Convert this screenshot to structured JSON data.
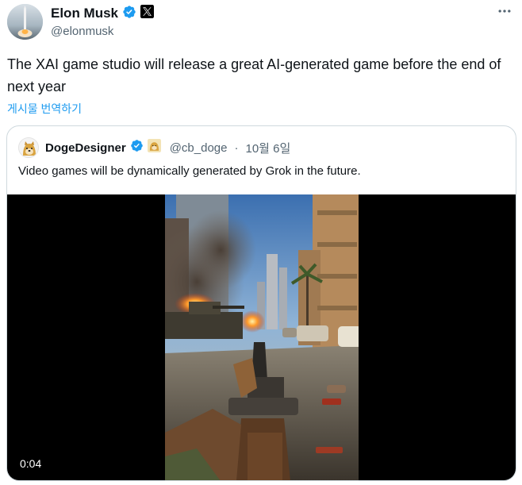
{
  "author": {
    "name": "Elon Musk",
    "handle": "@elonmusk",
    "verified_icon": "verified-badge-icon",
    "affiliate_icon": "x-logo-icon"
  },
  "tweet": {
    "text": "The XAI game studio will release a great AI-generated game before the end of next year",
    "translate_label": "게시물 번역하기"
  },
  "quote": {
    "name": "DogeDesigner",
    "handle": "@cb_doge",
    "separator": "·",
    "date": "10월 6일",
    "text": "Video games will be dynamically generated by Grok in the future.",
    "video": {
      "timecode": "0:04"
    }
  },
  "colors": {
    "verified": "#1d9bf0",
    "link": "#1d9bf0",
    "secondary_text": "#536471",
    "border": "#cfd9de"
  }
}
